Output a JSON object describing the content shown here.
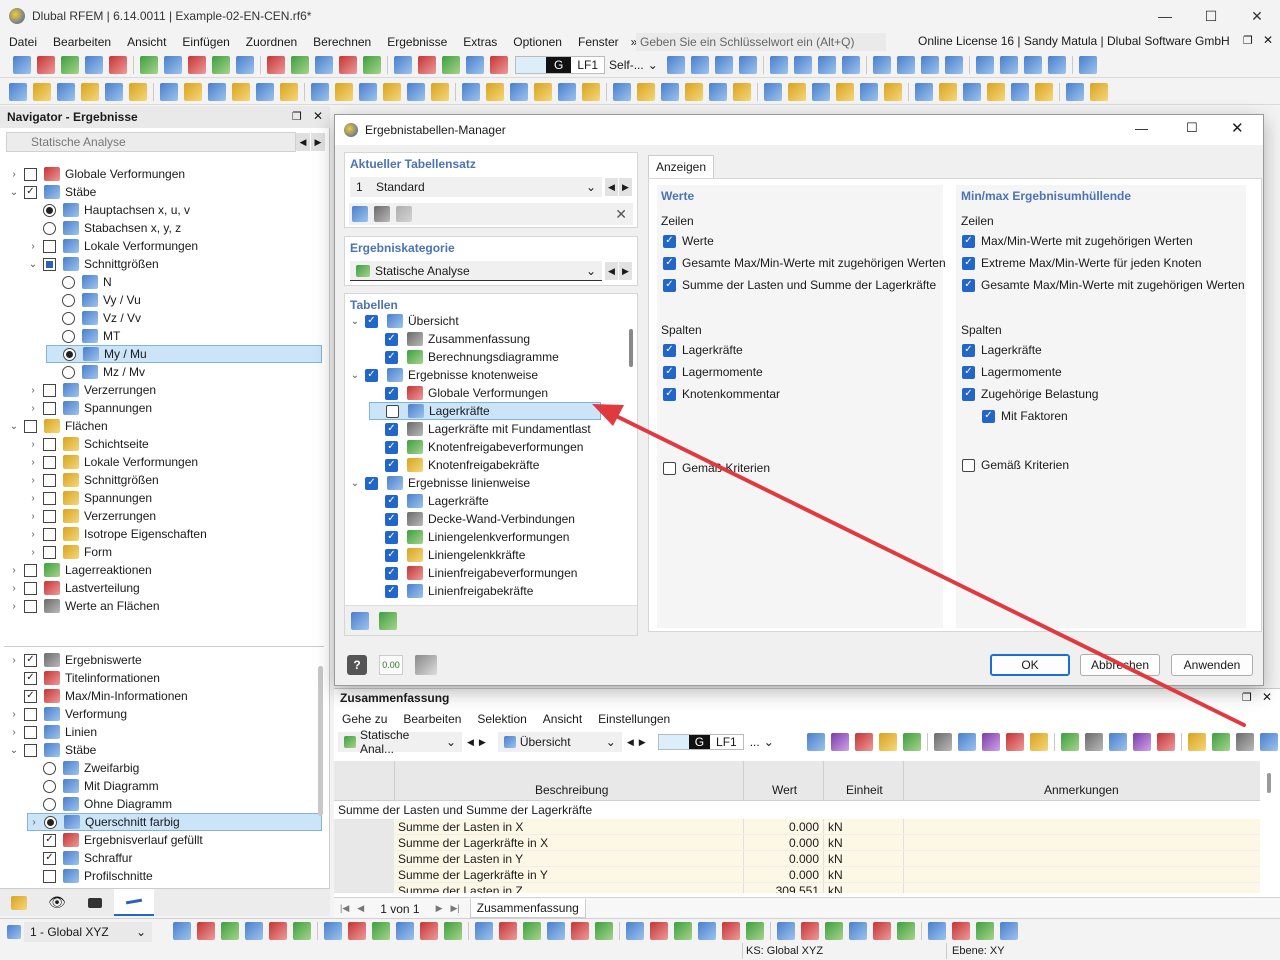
{
  "window": {
    "title": "Dlubal RFEM | 6.14.0011 | Example-02-EN-CEN.rf6*"
  },
  "menu": {
    "items": [
      "Datei",
      "Bearbeiten",
      "Ansicht",
      "Einfügen",
      "Zuordnen",
      "Berechnen",
      "Ergebnisse",
      "Extras",
      "Optionen",
      "Fenster"
    ],
    "overflow": "»",
    "search_placeholder": "Geben Sie ein Schlüsselwort ein (Alt+Q)",
    "license": "Online License 16 | Sandy Matula | Dlubal Software GmbH"
  },
  "toolbar1": {
    "load_case_code": "G",
    "load_case": "LF1",
    "self_weight": "Self-..."
  },
  "navigator": {
    "title": "Navigator - Ergebnisse",
    "analysis_combo": "Statische Analyse",
    "tree": [
      {
        "label": "Globale Verformungen",
        "level": 0,
        "expander": "›",
        "check": "off",
        "icon": "r"
      },
      {
        "label": "Stäbe",
        "level": 0,
        "expander": "⌄",
        "check": "on",
        "icon": "b"
      },
      {
        "label": "Hauptachsen x, u, v",
        "level": 1,
        "expander": "",
        "check": "radio-on",
        "icon": "b"
      },
      {
        "label": "Stabachsen x, y, z",
        "level": 1,
        "expander": "",
        "check": "radio",
        "icon": "b"
      },
      {
        "label": "Lokale Verformungen",
        "level": 1,
        "expander": "›",
        "check": "off",
        "icon": "b"
      },
      {
        "label": "Schnittgrößen",
        "level": 1,
        "expander": "⌄",
        "check": "partial",
        "icon": "b"
      },
      {
        "label": "N",
        "level": 2,
        "expander": "",
        "check": "radio",
        "icon": "b"
      },
      {
        "label": "Vy / Vu",
        "level": 2,
        "expander": "",
        "check": "radio",
        "icon": "b"
      },
      {
        "label": "Vz / Vv",
        "level": 2,
        "expander": "",
        "check": "radio",
        "icon": "b"
      },
      {
        "label": "MT",
        "level": 2,
        "expander": "",
        "check": "radio",
        "icon": "b"
      },
      {
        "label": "My / Mu",
        "level": 2,
        "expander": "",
        "check": "radio-on",
        "icon": "b",
        "selected": true
      },
      {
        "label": "Mz / Mv",
        "level": 2,
        "expander": "",
        "check": "radio",
        "icon": "b"
      },
      {
        "label": "Verzerrungen",
        "level": 1,
        "expander": "›",
        "check": "off",
        "icon": "b"
      },
      {
        "label": "Spannungen",
        "level": 1,
        "expander": "›",
        "check": "off",
        "icon": "b"
      },
      {
        "label": "Flächen",
        "level": 0,
        "expander": "⌄",
        "check": "off",
        "icon": "y"
      },
      {
        "label": "Schichtseite",
        "level": 1,
        "expander": "›",
        "check": "off",
        "icon": "y"
      },
      {
        "label": "Lokale Verformungen",
        "level": 1,
        "expander": "›",
        "check": "off",
        "icon": "y"
      },
      {
        "label": "Schnittgrößen",
        "level": 1,
        "expander": "›",
        "check": "off",
        "icon": "y"
      },
      {
        "label": "Spannungen",
        "level": 1,
        "expander": "›",
        "check": "off",
        "icon": "y"
      },
      {
        "label": "Verzerrungen",
        "level": 1,
        "expander": "›",
        "check": "off",
        "icon": "y"
      },
      {
        "label": "Isotrope Eigenschaften",
        "level": 1,
        "expander": "›",
        "check": "off",
        "icon": "y"
      },
      {
        "label": "Form",
        "level": 1,
        "expander": "›",
        "check": "off",
        "icon": "y"
      },
      {
        "label": "Lagerreaktionen",
        "level": 0,
        "expander": "›",
        "check": "off",
        "icon": "gr"
      },
      {
        "label": "Lastverteilung",
        "level": 0,
        "expander": "›",
        "check": "off",
        "icon": "r"
      },
      {
        "label": "Werte an Flächen",
        "level": 0,
        "expander": "›",
        "check": "off",
        "icon": "g"
      }
    ],
    "tree2": [
      {
        "label": "Ergebniswerte",
        "level": 0,
        "expander": "›",
        "check": "on",
        "icon": "g"
      },
      {
        "label": "Titelinformationen",
        "level": 0,
        "expander": "",
        "check": "on",
        "icon": "r"
      },
      {
        "label": "Max/Min-Informationen",
        "level": 0,
        "expander": "",
        "check": "on",
        "icon": "r"
      },
      {
        "label": "Verformung",
        "level": 0,
        "expander": "›",
        "check": "off",
        "icon": "b"
      },
      {
        "label": "Linien",
        "level": 0,
        "expander": "›",
        "check": "off",
        "icon": "b"
      },
      {
        "label": "Stäbe",
        "level": 0,
        "expander": "⌄",
        "check": "off",
        "icon": "b"
      },
      {
        "label": "Zweifarbig",
        "level": 1,
        "expander": "",
        "check": "radio",
        "icon": "b"
      },
      {
        "label": "Mit Diagramm",
        "level": 1,
        "expander": "",
        "check": "radio",
        "icon": "b"
      },
      {
        "label": "Ohne Diagramm",
        "level": 1,
        "expander": "",
        "check": "radio",
        "icon": "b"
      },
      {
        "label": "Querschnitt farbig",
        "level": 1,
        "expander": "›",
        "check": "radio-on",
        "icon": "b",
        "selected": true
      },
      {
        "label": "Ergebnisverlauf gefüllt",
        "level": 1,
        "expander": "",
        "check": "on",
        "icon": "r"
      },
      {
        "label": "Schraffur",
        "level": 1,
        "expander": "",
        "check": "on",
        "icon": "b"
      },
      {
        "label": "Profilschnitte",
        "level": 1,
        "expander": "",
        "check": "off",
        "icon": "b"
      }
    ]
  },
  "dialog": {
    "title": "Ergebnistabellen-Manager",
    "current_set_label": "Aktueller Tabellensatz",
    "current_set_no": "1",
    "current_set_name": "Standard",
    "category_label": "Ergebniskategorie",
    "category_value": "Statische Analyse",
    "tables_label": "Tabellen",
    "tables": [
      {
        "label": "Übersicht",
        "level": 0,
        "expander": "⌄",
        "checked": true
      },
      {
        "label": "Zusammenfassung",
        "level": 1,
        "checked": true
      },
      {
        "label": "Berechnungsdiagramme",
        "level": 1,
        "checked": true
      },
      {
        "label": "Ergebnisse knotenweise",
        "level": 0,
        "expander": "⌄",
        "checked": true
      },
      {
        "label": "Globale Verformungen",
        "level": 1,
        "checked": true
      },
      {
        "label": "Lagerkräfte",
        "level": 1,
        "checked": false,
        "selected": true
      },
      {
        "label": "Lagerkräfte mit Fundamentlast",
        "level": 1,
        "checked": true
      },
      {
        "label": "Knotenfreigabeverformungen",
        "level": 1,
        "checked": true
      },
      {
        "label": "Knotenfreigabekräfte",
        "level": 1,
        "checked": true
      },
      {
        "label": "Ergebnisse linienweise",
        "level": 0,
        "expander": "⌄",
        "checked": true
      },
      {
        "label": "Lagerkräfte",
        "level": 1,
        "checked": true
      },
      {
        "label": "Decke-Wand-Verbindungen",
        "level": 1,
        "checked": true
      },
      {
        "label": "Liniengelenkverformungen",
        "level": 1,
        "checked": true
      },
      {
        "label": "Liniengelenkkräfte",
        "level": 1,
        "checked": true
      },
      {
        "label": "Linienfreigabeverformungen",
        "level": 1,
        "checked": true
      },
      {
        "label": "Linienfreigabekräfte",
        "level": 1,
        "checked": true
      }
    ],
    "tab": "Anzeigen",
    "values_panel": {
      "title": "Werte",
      "rows_label": "Zeilen",
      "rows": [
        {
          "label": "Werte",
          "checked": true
        },
        {
          "label": "Gesamte Max/Min-Werte mit zugehörigen Werten",
          "checked": true
        },
        {
          "label": "Summe der Lasten und Summe der Lagerkräfte",
          "checked": true
        }
      ],
      "cols_label": "Spalten",
      "cols": [
        {
          "label": "Lagerkräfte",
          "checked": true
        },
        {
          "label": "Lagermomente",
          "checked": true
        },
        {
          "label": "Knotenkommentar",
          "checked": true
        }
      ],
      "criteria": "Gemäß Kriterien"
    },
    "envelope_panel": {
      "title": "Min/max Ergebnisumhüllende",
      "rows_label": "Zeilen",
      "rows": [
        {
          "label": "Max/Min-Werte mit zugehörigen Werten",
          "checked": true
        },
        {
          "label": "Extreme Max/Min-Werte für jeden Knoten",
          "checked": true
        },
        {
          "label": "Gesamte Max/Min-Werte mit zugehörigen Werten",
          "checked": true
        }
      ],
      "cols_label": "Spalten",
      "cols": [
        {
          "label": "Lagerkräfte",
          "checked": true,
          "indent": false
        },
        {
          "label": "Lagermomente",
          "checked": true,
          "indent": false
        },
        {
          "label": "Zugehörige Belastung",
          "checked": true,
          "indent": false
        },
        {
          "label": "Mit Faktoren",
          "checked": true,
          "indent": true
        }
      ],
      "criteria": "Gemäß Kriterien"
    },
    "ok": "OK",
    "cancel": "Abbrechen",
    "apply": "Anwenden",
    "units_icon": "0.00"
  },
  "summary": {
    "title": "Zusammenfassung",
    "menu": [
      "Gehe zu",
      "Bearbeiten",
      "Selektion",
      "Ansicht",
      "Einstellungen"
    ],
    "analysis": "Statische Anal...",
    "table": "Übersicht",
    "lc_code": "G",
    "lc": "LF1",
    "lc_more": "...",
    "columns": [
      "Beschreibung",
      "Wert",
      "Einheit",
      "Anmerkungen"
    ],
    "group": "Summe der Lasten und Summe der Lagerkräfte",
    "rows": [
      {
        "desc": "Summe der Lasten in X",
        "value": "0.000",
        "unit": "kN"
      },
      {
        "desc": "Summe der Lagerkräfte in X",
        "value": "0.000",
        "unit": "kN"
      },
      {
        "desc": "Summe der Lasten in Y",
        "value": "0.000",
        "unit": "kN"
      },
      {
        "desc": "Summe der Lagerkräfte in Y",
        "value": "0.000",
        "unit": "kN"
      },
      {
        "desc": "Summe der Lasten in Z",
        "value": "309.551",
        "unit": "kN"
      }
    ],
    "pager": "1 von 1",
    "sheet_tab": "Zusammenfassung"
  },
  "status": {
    "coord_system": "1 - Global XYZ",
    "ks": "KS: Global XYZ",
    "plane": "Ebene: XY"
  },
  "colors": {
    "accent": "#2166c8",
    "arrow": "#e0393e",
    "selection": "#cce4f7",
    "panel_title": "#4b73b5"
  }
}
